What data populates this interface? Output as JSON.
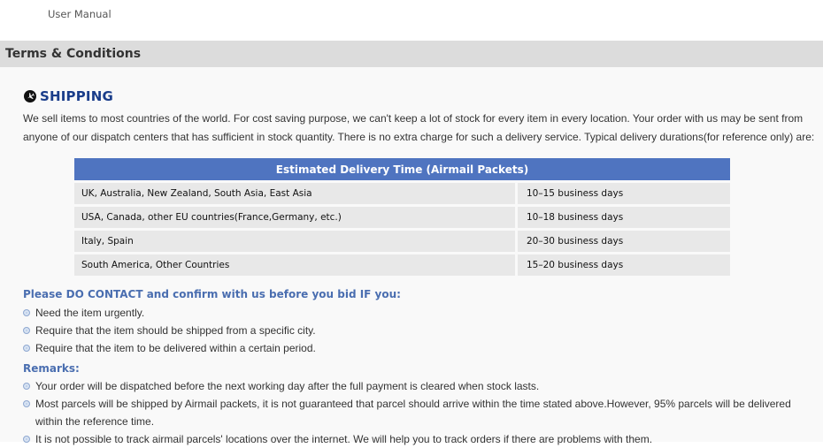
{
  "header": {
    "manual_link": "User Manual"
  },
  "terms_bar": {
    "title": "Terms & Conditions"
  },
  "shipping": {
    "title": "SHIPPING",
    "icon": "airplane-icon",
    "intro": "We sell items to most countries of the world. For cost saving purpose, we can't keep a lot of stock for every item in every location. Your order with us may be sent from anyone of our dispatch centers that has sufficient in stock quantity. There is no extra charge for such a delivery service. Typical delivery durations(for reference only) are:"
  },
  "delivery_table": {
    "header": "Estimated Delivery Time (Airmail Packets)",
    "rows": [
      {
        "region": "UK, Australia, New Zealand, South Asia, East Asia",
        "days": "10–15 business days"
      },
      {
        "region": "USA, Canada, other EU countries(France,Germany, etc.)",
        "days": "10–18 business days"
      },
      {
        "region": "Italy, Spain",
        "days": "20–30 business days"
      },
      {
        "region": "South America, Other Countries",
        "days": "15–20 business days"
      }
    ]
  },
  "contact": {
    "heading": "Please DO CONTACT and confirm with us before you bid IF you:",
    "items": [
      "Need the item urgently.",
      "Require that the item should be shipped from a specific city.",
      "Require that the item to be delivered within a certain period."
    ]
  },
  "remarks": {
    "heading": "Remarks:",
    "items": [
      "Your order will be dispatched before the next working day after the full payment is cleared when stock lasts.",
      "Most parcels will be shipped by Airmail packets, it is not guaranteed that parcel should arrive within the time stated above.However, 95% parcels will be delivered within the reference time.",
      "It is not possible to track airmail parcels' locations over the internet. We will help you to track orders if there are problems with them."
    ]
  },
  "colors": {
    "accent": "#1a3d8a",
    "table_header": "#4f74c0",
    "subheading": "#4a6eb0",
    "bar": "#dcdcdc"
  }
}
